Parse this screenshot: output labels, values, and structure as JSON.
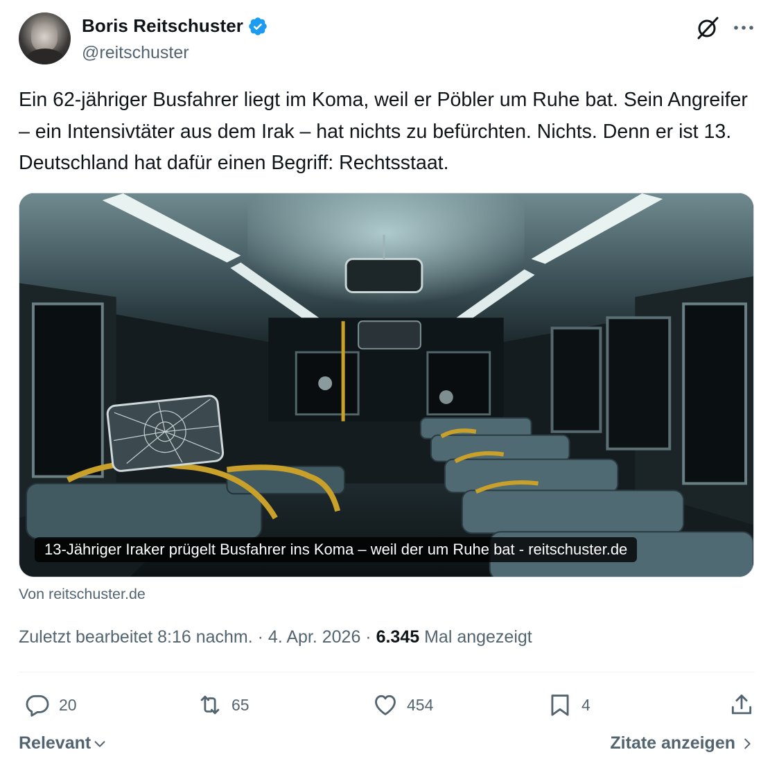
{
  "author": {
    "display_name": "Boris Reitschuster",
    "handle": "@reitschuster",
    "verified": true
  },
  "header_icons": [
    "grok-icon",
    "more-icon"
  ],
  "tweet": {
    "text": "Ein 62-jähriger Busfahrer liegt im Koma, weil er Pöbler um Ruhe bat. Sein Angreifer – ein Intensivtäter aus dem Irak – hat nichts zu befürchten. Nichts. Denn er ist 13. Deutschland hat dafür einen Begriff: Rechtsstaat."
  },
  "card": {
    "caption": "13-Jähriger Iraker prügelt Busfahrer ins Koma – weil der um Ruhe bat - reitschuster.de",
    "source": "Von reitschuster.de"
  },
  "meta": {
    "edited": "Zuletzt bearbeitet 8:16 nachm. · 4. Apr. 2026 · ",
    "views_count": "6.345",
    "views_label": " Mal angezeigt"
  },
  "actions": {
    "replies": "20",
    "reposts": "65",
    "likes": "454",
    "bookmarks": "4"
  },
  "footer": {
    "sort_label": "Relevant",
    "quotes_label": "Zitate anzeigen"
  },
  "colors": {
    "text_primary": "#0f1419",
    "text_secondary": "#536471",
    "verified_blue": "#1d9bf0",
    "divider": "#eff3f4"
  }
}
